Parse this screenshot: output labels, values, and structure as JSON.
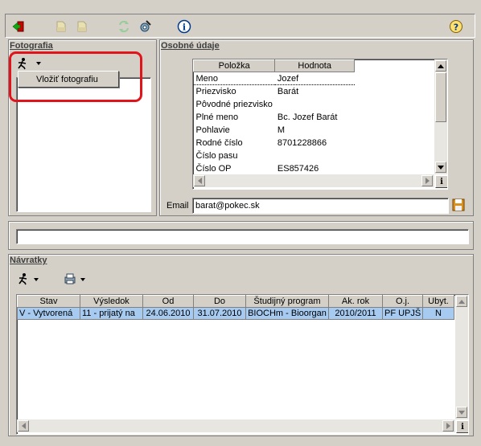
{
  "toolbar": {
    "icons": [
      "exit-icon",
      "document-icon",
      "document-icon",
      "refresh-icon",
      "settings-icon",
      "info-icon",
      "help-icon"
    ],
    "info_glyph": "i",
    "help_glyph": "?"
  },
  "photo_panel": {
    "title": "Fotografia",
    "menu_item": "Vložiť fotografiu"
  },
  "personal_panel": {
    "title": "Osobné údaje",
    "columns": [
      "Položka",
      "Hodnota"
    ],
    "rows": [
      {
        "item": "Meno",
        "value": "Jozef"
      },
      {
        "item": "Priezvisko",
        "value": "Barát"
      },
      {
        "item": "Pôvodné priezvisko",
        "value": ""
      },
      {
        "item": "Plné meno",
        "value": "Bc. Jozef Barát"
      },
      {
        "item": "Pohlavie",
        "value": "M"
      },
      {
        "item": "Rodné číslo",
        "value": "8701228866"
      },
      {
        "item": "Číslo pasu",
        "value": ""
      },
      {
        "item": "Číslo OP",
        "value": "ES857426"
      }
    ],
    "email_label": "Email",
    "email_value": "barat@pokec.sk"
  },
  "returns_panel": {
    "title": "Návratky",
    "columns": [
      "Stav",
      "Výsledok",
      "Od",
      "Do",
      "Študijný program",
      "Ak. rok",
      "O.j.",
      "Ubyt."
    ],
    "rows": [
      [
        "V - Vytvorená",
        "11 - prijatý na",
        "24.06.2010",
        "31.07.2010",
        "BIOCHm - Bioorgan",
        "2010/2011",
        "PF UPJŠ",
        "N"
      ]
    ]
  }
}
